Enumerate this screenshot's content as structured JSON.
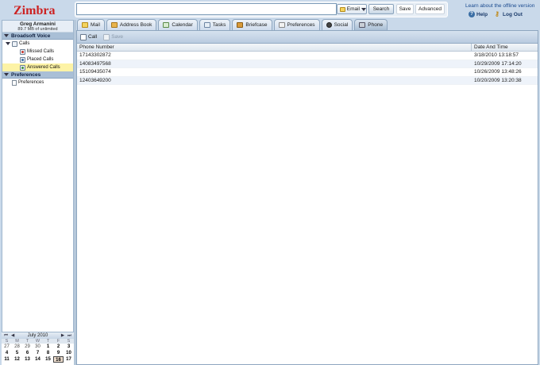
{
  "header": {
    "logo_text": "Zimbra",
    "search_placeholder": "",
    "search_type": "Email",
    "search_button": "Search",
    "save_button": "Save",
    "advanced_button": "Advanced",
    "offline_link": "Learn about the offline version",
    "help_label": "Help",
    "logout_label": "Log Out"
  },
  "user": {
    "name": "Greg Armanini",
    "quota": "89.7 MB of unlimited"
  },
  "sidebar": {
    "section1": "Broadsoft Voice",
    "calls": "Calls",
    "missed": "Missed Calls",
    "placed": "Placed Calls",
    "answered": "Answered Calls",
    "section2": "Preferences",
    "preferences_item": "Preferences"
  },
  "calendar": {
    "month": "July 2010",
    "days": [
      "S",
      "M",
      "T",
      "W",
      "T",
      "F",
      "S"
    ],
    "row1": [
      "27",
      "28",
      "29",
      "30",
      "1",
      "2",
      "3"
    ],
    "row2": [
      "4",
      "5",
      "6",
      "7",
      "8",
      "9",
      "10"
    ],
    "row3": [
      "11",
      "12",
      "13",
      "14",
      "15",
      "16",
      "17"
    ]
  },
  "tabs": [
    "Mail",
    "Address Book",
    "Calendar",
    "Tasks",
    "Briefcase",
    "Preferences",
    "Social",
    "Phone"
  ],
  "toolbar": {
    "call": "Call",
    "save": "Save"
  },
  "table": {
    "col_phone": "Phone Number",
    "col_date": "Date And Time",
    "rows": [
      {
        "phone": "17143302872",
        "date": "3/18/2010 13:18:57"
      },
      {
        "phone": "14083497568",
        "date": "10/29/2009 17:14:20"
      },
      {
        "phone": "15109435074",
        "date": "10/26/2009 13:48:26"
      },
      {
        "phone": "12403649200",
        "date": "10/20/2009 13:20:38"
      }
    ]
  }
}
